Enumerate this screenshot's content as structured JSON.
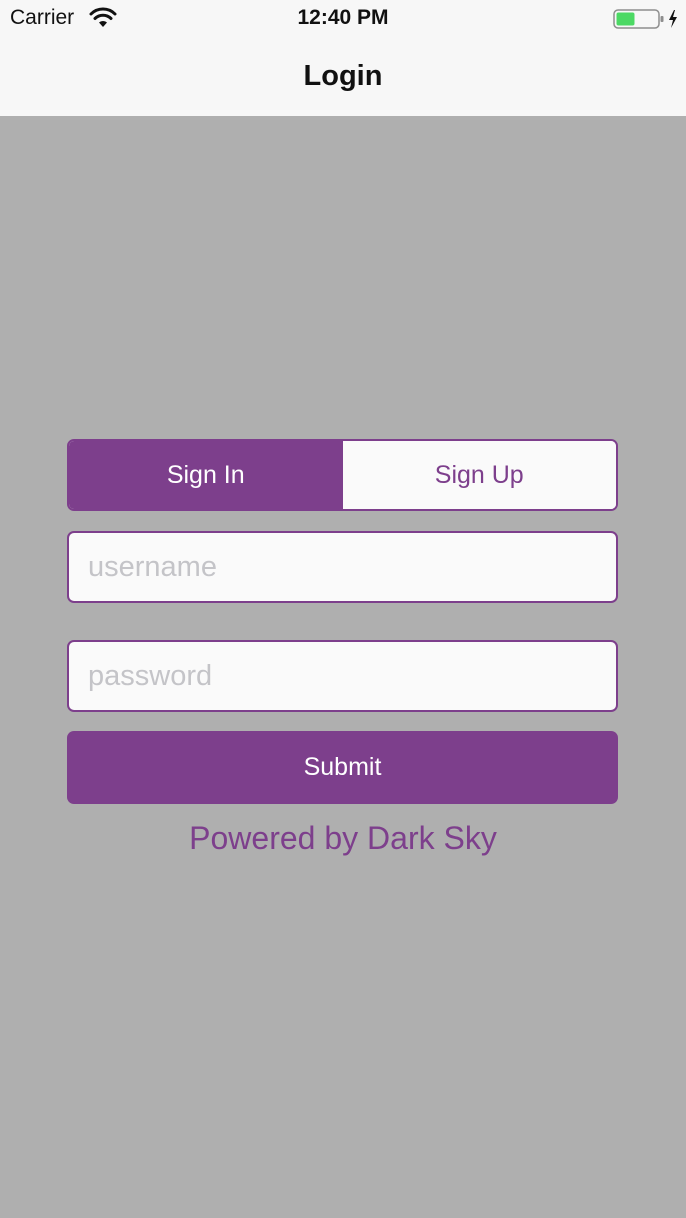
{
  "status_bar": {
    "carrier": "Carrier",
    "time": "12:40 PM",
    "battery_level": 0.45,
    "charging": true,
    "icons": [
      "wifi-icon",
      "battery-icon",
      "charging-bolt-icon"
    ]
  },
  "nav": {
    "title": "Login"
  },
  "segmented_control": {
    "options": [
      "Sign In",
      "Sign Up"
    ],
    "selected": "Sign In"
  },
  "form": {
    "username_placeholder": "username",
    "username_value": "",
    "password_placeholder": "password",
    "password_value": "",
    "submit_label": "Submit"
  },
  "footer": {
    "powered_by": "Powered by Dark Sky"
  },
  "colors": {
    "accent": "#7d3f8c",
    "background": "#afafaf",
    "bar": "#f7f7f7",
    "battery_fill": "#4cd964"
  }
}
